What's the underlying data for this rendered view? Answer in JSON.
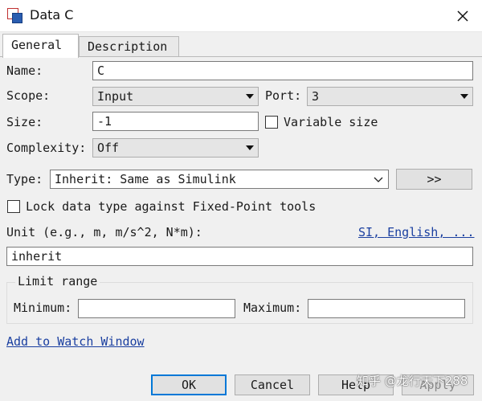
{
  "window": {
    "title": "Data C",
    "close_glyph": "✕"
  },
  "tabs": [
    {
      "label": "General",
      "active": true
    },
    {
      "label": "Description",
      "active": false
    }
  ],
  "form": {
    "name_label": "Name:",
    "name_value": "C",
    "scope_label": "Scope:",
    "scope_value": "Input",
    "port_label": "Port:",
    "port_value": "3",
    "size_label": "Size:",
    "size_value": "-1",
    "variable_size_label": "Variable size",
    "variable_size_checked": false,
    "complexity_label": "Complexity:",
    "complexity_value": "Off",
    "type_label": "Type:",
    "type_value": "Inherit: Same as Simulink",
    "type_assistant_label": ">>",
    "lock_label": "Lock data type against Fixed-Point tools",
    "lock_checked": false,
    "unit_label": "Unit (e.g., m, m/s^2, N*m):",
    "unit_link": "SI, English, ...",
    "unit_value": "inherit"
  },
  "limit_range": {
    "title": "Limit range",
    "minimum_label": "Minimum:",
    "minimum_value": "",
    "maximum_label": "Maximum:",
    "maximum_value": ""
  },
  "watch_link": "Add to Watch Window",
  "buttons": {
    "ok": "OK",
    "cancel": "Cancel",
    "help": "Help",
    "apply": "Apply"
  },
  "watermark": "知乎 @龙行天下288",
  "colors": {
    "focus_border": "#0078d7",
    "link": "#1a3fa0",
    "panel_bg": "#f0f0f0"
  }
}
